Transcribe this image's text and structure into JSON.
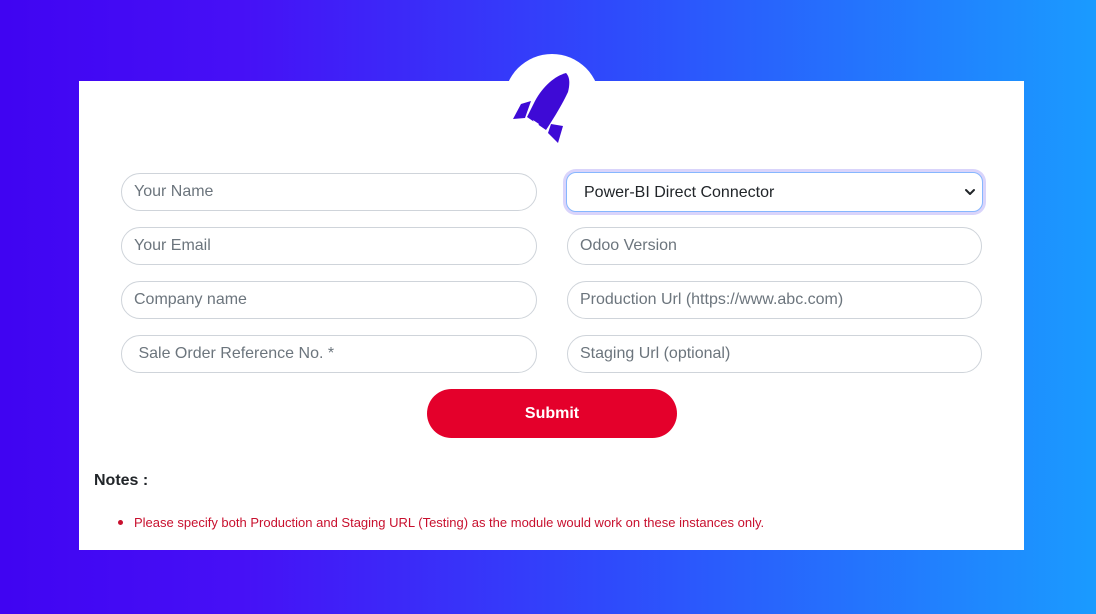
{
  "colors": {
    "background_start": "#4004f2",
    "background_end": "#1a9bff",
    "card": "#ffffff",
    "rocket": "#3e0ad6",
    "submit_button": "#e4002b",
    "note_text": "#c8102e"
  },
  "header": {
    "icon": "rocket-icon"
  },
  "form": {
    "name_placeholder": "Your Name",
    "email_placeholder": "Your Email",
    "company_placeholder": "Company name",
    "sale_order_placeholder": " Sale Order Reference No. *",
    "module_select": {
      "selected": "Power-BI Direct Connector",
      "icon": "chevron-down-icon"
    },
    "odoo_version_placeholder": "Odoo Version",
    "production_url_placeholder": "Production Url (https://www.abc.com)",
    "staging_url_placeholder": "Staging Url (optional)",
    "submit_label": "Submit"
  },
  "notes": {
    "title": "Notes :",
    "items": [
      "Please specify both Production and Staging URL (Testing) as the module would work on these instances only."
    ]
  }
}
